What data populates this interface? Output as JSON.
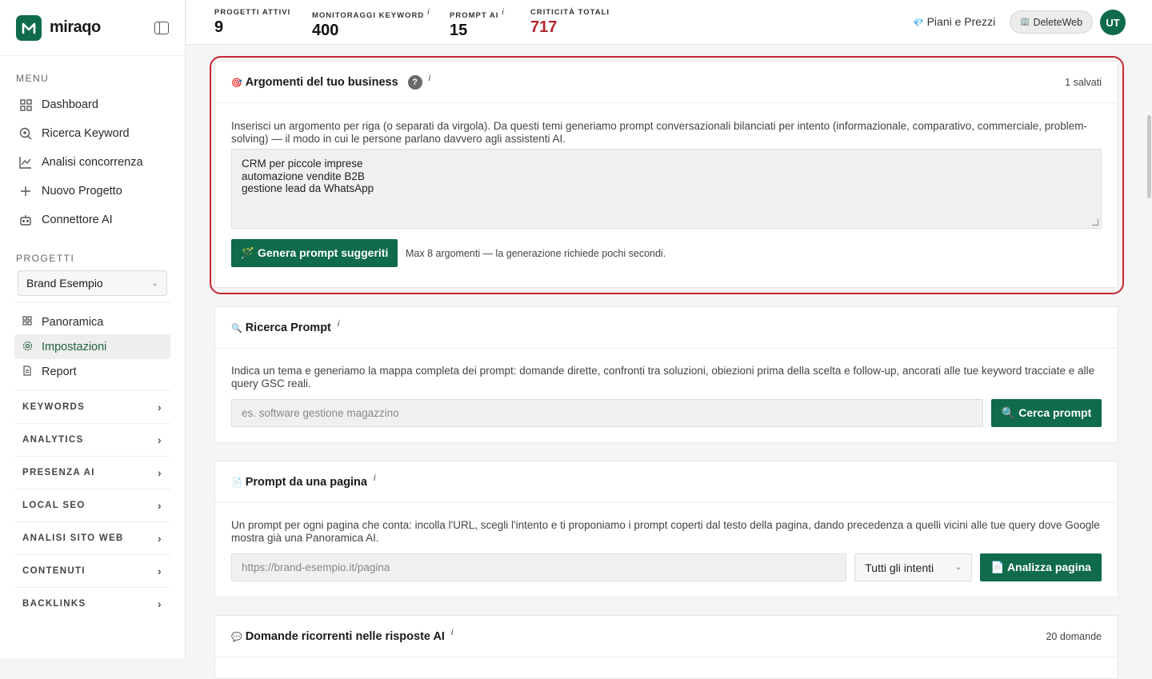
{
  "app": {
    "name": "miraqo"
  },
  "sidebar": {
    "menu_title": "MENU",
    "menu": [
      {
        "label": "Dashboard",
        "icon": "grid-icon"
      },
      {
        "label": "Ricerca Keyword",
        "icon": "search-icon"
      },
      {
        "label": "Analisi concorrenza",
        "icon": "chart-line-icon"
      },
      {
        "label": "Nuovo Progetto",
        "icon": "plus-icon"
      },
      {
        "label": "Connettore AI",
        "icon": "robot-icon"
      }
    ],
    "projects_title": "PROGETTI",
    "project_selected": "Brand Esempio",
    "project_items": [
      {
        "label": "Panoramica",
        "icon": "grid-icon"
      },
      {
        "label": "Impostazioni",
        "icon": "gear-icon",
        "active": true
      },
      {
        "label": "Report",
        "icon": "document-icon"
      }
    ],
    "groups": [
      "KEYWORDS",
      "ANALYTICS",
      "PRESENZA AI",
      "LOCAL SEO",
      "ANALISI SITO WEB",
      "CONTENUTI",
      "BACKLINKS"
    ]
  },
  "topbar": {
    "stats": [
      {
        "label": "PROGETTI ATTIVI",
        "value": "9",
        "info": ""
      },
      {
        "label": "MONITORAGGI KEYWORD",
        "value": "400",
        "info": "i"
      },
      {
        "label": "PROMPT AI",
        "value": "15",
        "info": "i"
      },
      {
        "label": "CRITICITÀ TOTALI",
        "value": "717",
        "info": ""
      }
    ],
    "plans": "Piani e Prezzi",
    "workspace": "DeleteWeb",
    "avatar": "UT"
  },
  "cards": {
    "argomenti": {
      "emoji": "🎯",
      "title": "Argomenti del tuo business",
      "help": "?",
      "info": "i",
      "count": "1 salvati",
      "description": "Inserisci un argomento per riga (o separati da virgola). Da questi temi generiamo prompt conversazionali bilanciati per intento (informazionale, comparativo, commerciale, problem-solving) — il modo in cui le persone parlano davvero agli assistenti AI.",
      "textarea": "CRM per piccole imprese\nautomazione vendite B2B\ngestione lead da WhatsApp",
      "button": "🪄 Genera prompt suggeriti",
      "note": "Max 8 argomenti — la generazione richiede pochi secondi."
    },
    "ricerca": {
      "emoji": "🔍",
      "title": "Ricerca Prompt",
      "info": "i",
      "description": "Indica un tema e generiamo la mappa completa dei prompt: domande dirette, confronti tra soluzioni, obiezioni prima della scelta e follow-up, ancorati alle tue keyword tracciate e alle query GSC reali.",
      "placeholder": "es. software gestione magazzino",
      "button": "🔍 Cerca prompt"
    },
    "pagina": {
      "emoji": "📄",
      "title": "Prompt da una pagina",
      "info": "i",
      "description": "Un prompt per ogni pagina che conta: incolla l'URL, scegli l'intento e ti proponiamo i prompt coperti dal testo della pagina, dando precedenza a quelli vicini alle tue query dove Google mostra già una Panoramica AI.",
      "placeholder": "https://brand-esempio.it/pagina",
      "select": "Tutti gli intenti",
      "button": "📄 Analizza pagina"
    },
    "domande": {
      "emoji": "💬",
      "title": "Domande ricorrenti nelle risposte AI",
      "info": "i",
      "count": "20 domande"
    }
  },
  "colors": {
    "accent": "#0f6b4a",
    "danger": "#b3262e",
    "highlight": "#c7263a"
  }
}
